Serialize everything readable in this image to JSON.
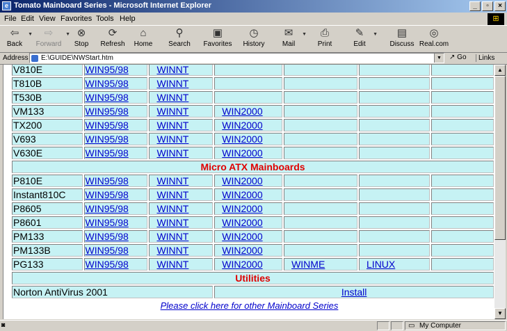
{
  "window": {
    "title": "Tomato Mainboard Series - Microsoft Internet Explorer"
  },
  "menu": [
    "File",
    "Edit",
    "View",
    "Favorites",
    "Tools",
    "Help"
  ],
  "toolbar": {
    "back": "Back",
    "forward": "Forward",
    "stop": "Stop",
    "refresh": "Refresh",
    "home": "Home",
    "search": "Search",
    "favorites": "Favorites",
    "history": "History",
    "mail": "Mail",
    "print": "Print",
    "edit": "Edit",
    "discuss": "Discuss",
    "realcom": "Real.com"
  },
  "address": {
    "label": "Address",
    "url": "E:\\GUIDE\\NWStart.htm",
    "go": "Go",
    "links": "Links"
  },
  "table": {
    "rows": [
      {
        "name": "V810E",
        "c1": "WIN95/98",
        "c2": "WINNT",
        "c3": "",
        "c4": "",
        "c5": "",
        "c6": ""
      },
      {
        "name": "T810B",
        "c1": "WIN95/98",
        "c2": "WINNT",
        "c3": "",
        "c4": "",
        "c5": "",
        "c6": ""
      },
      {
        "name": "T530B",
        "c1": "WIN95/98",
        "c2": "WINNT",
        "c3": "",
        "c4": "",
        "c5": "",
        "c6": ""
      },
      {
        "name": "VM133",
        "c1": "WIN95/98",
        "c2": "WINNT",
        "c3": "WIN2000",
        "c4": "",
        "c5": "",
        "c6": ""
      },
      {
        "name": "TX200",
        "c1": "WIN95/98",
        "c2": "WINNT",
        "c3": "WIN2000",
        "c4": "",
        "c5": "",
        "c6": ""
      },
      {
        "name": "V693",
        "c1": "WIN95/98",
        "c2": "WINNT",
        "c3": "WIN2000",
        "c4": "",
        "c5": "",
        "c6": ""
      },
      {
        "name": "V630E",
        "c1": "WIN95/98",
        "c2": "WINNT",
        "c3": "WIN2000",
        "c4": "",
        "c5": "",
        "c6": ""
      }
    ],
    "section_micro_atx": "Micro ATX Mainboards",
    "rows2": [
      {
        "name": "P810E",
        "c1": "WIN95/98",
        "c2": "WINNT",
        "c3": "WIN2000",
        "c4": "",
        "c5": "",
        "c6": ""
      },
      {
        "name": "Instant810C",
        "c1": "WIN95/98",
        "c2": "WINNT",
        "c3": "WIN2000",
        "c4": "",
        "c5": "",
        "c6": ""
      },
      {
        "name": "P8605",
        "c1": "WIN95/98",
        "c2": "WINNT",
        "c3": "WIN2000",
        "c4": "",
        "c5": "",
        "c6": ""
      },
      {
        "name": "P8601",
        "c1": "WIN95/98",
        "c2": "WINNT",
        "c3": "WIN2000",
        "c4": "",
        "c5": "",
        "c6": ""
      },
      {
        "name": "PM133",
        "c1": "WIN95/98",
        "c2": "WINNT",
        "c3": "WIN2000",
        "c4": "",
        "c5": "",
        "c6": ""
      },
      {
        "name": "PM133B",
        "c1": "WIN95/98",
        "c2": "WINNT",
        "c3": "WIN2000",
        "c4": "",
        "c5": "",
        "c6": ""
      },
      {
        "name": "PG133",
        "c1": "WIN95/98",
        "c2": "WINNT",
        "c3": "WIN2000",
        "c4": "WINME",
        "c5": "LINUX",
        "c6": ""
      }
    ],
    "section_utilities": "Utilities",
    "utility": {
      "name": "Norton AntiVirus 2001",
      "action": "Install"
    }
  },
  "footer_link": "Please click here for other Mainboard Series",
  "status": {
    "zone": "My Computer"
  },
  "colors": {
    "cell_bg": "#c6f2f4",
    "link": "#0000cc",
    "section": "#e00000",
    "titlebar": "#0a246a"
  }
}
